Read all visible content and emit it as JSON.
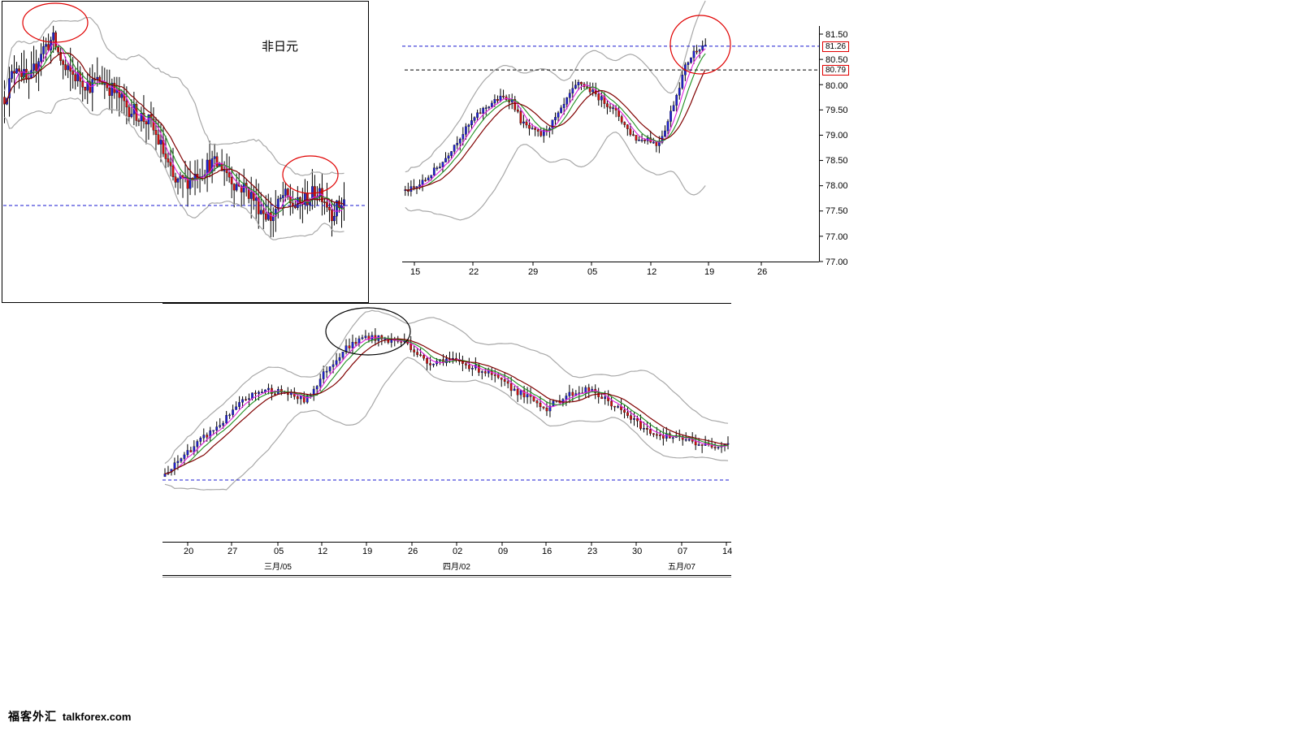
{
  "chart_data": [
    {
      "type": "candlestick",
      "panel": "top-left",
      "title": "非日元",
      "indicators": [
        "bollinger-bands",
        "moving-averages"
      ],
      "reference_line": "dashed blue horizontal",
      "annotations": [
        "red circle at early high",
        "red circle at late-range highs"
      ],
      "close_path": [
        6.2,
        7.4,
        6.6,
        7.8,
        8.2,
        7.1,
        6.9,
        6.6,
        6.8,
        6.4,
        5.9,
        5.6,
        5.3,
        4.4,
        3.2,
        3.3,
        3.6,
        3.9,
        3.8,
        3.2,
        3.0,
        2.4,
        2.0,
        2.8,
        2.4,
        2.7,
        3.0,
        2.2,
        2.6
      ]
    },
    {
      "type": "candlestick",
      "panel": "top-right",
      "indicators": [
        "bollinger-bands",
        "moving-averages"
      ],
      "ylim": [
        77.0,
        81.5
      ],
      "y_ticks": [
        "81.50",
        "81.00",
        "80.50",
        "80.00",
        "79.50",
        "79.00",
        "78.50",
        "78.00",
        "77.50",
        "77.00"
      ],
      "x_ticks": [
        "15",
        "22",
        "29",
        "05",
        "12",
        "19",
        "26"
      ],
      "reference_lines": [
        81.26,
        80.79
      ],
      "price_labels": [
        "81.26",
        "80.79"
      ],
      "annotations": [
        "red circle around latest highs"
      ],
      "close_path": [
        78.4,
        78.45,
        78.6,
        78.8,
        79.0,
        79.3,
        79.55,
        79.8,
        80.0,
        80.15,
        80.25,
        80.2,
        79.75,
        79.6,
        79.5,
        79.7,
        79.95,
        80.3,
        80.55,
        80.4,
        80.25,
        80.1,
        79.9,
        79.6,
        79.4,
        79.45,
        79.3,
        79.7,
        80.3,
        80.9,
        81.2,
        81.3
      ]
    },
    {
      "type": "candlestick",
      "panel": "bottom",
      "indicators": [
        "bollinger-bands",
        "moving-averages"
      ],
      "x_ticks": [
        "20",
        "27",
        "05",
        "12",
        "19",
        "26",
        "02",
        "09",
        "16",
        "23",
        "30",
        "07",
        "14"
      ],
      "month_labels": [
        "三月/05",
        "四月/02",
        "五月/07"
      ],
      "reference_line": "dashed blue horizontal",
      "annotations": [
        "black circle around mid-March top"
      ],
      "close_path": [
        1.0,
        2.2,
        3.1,
        4.0,
        5.1,
        5.6,
        5.4,
        5.0,
        6.6,
        7.8,
        8.4,
        8.2,
        8.1,
        7.0,
        7.2,
        6.9,
        6.5,
        5.8,
        5.2,
        4.6,
        5.3,
        5.6,
        5.0,
        4.2,
        3.4,
        3.1,
        2.9,
        2.6,
        2.8
      ]
    }
  ],
  "footer": {
    "brand_cn": "福客外汇",
    "brand_url": "talkforex.com"
  }
}
